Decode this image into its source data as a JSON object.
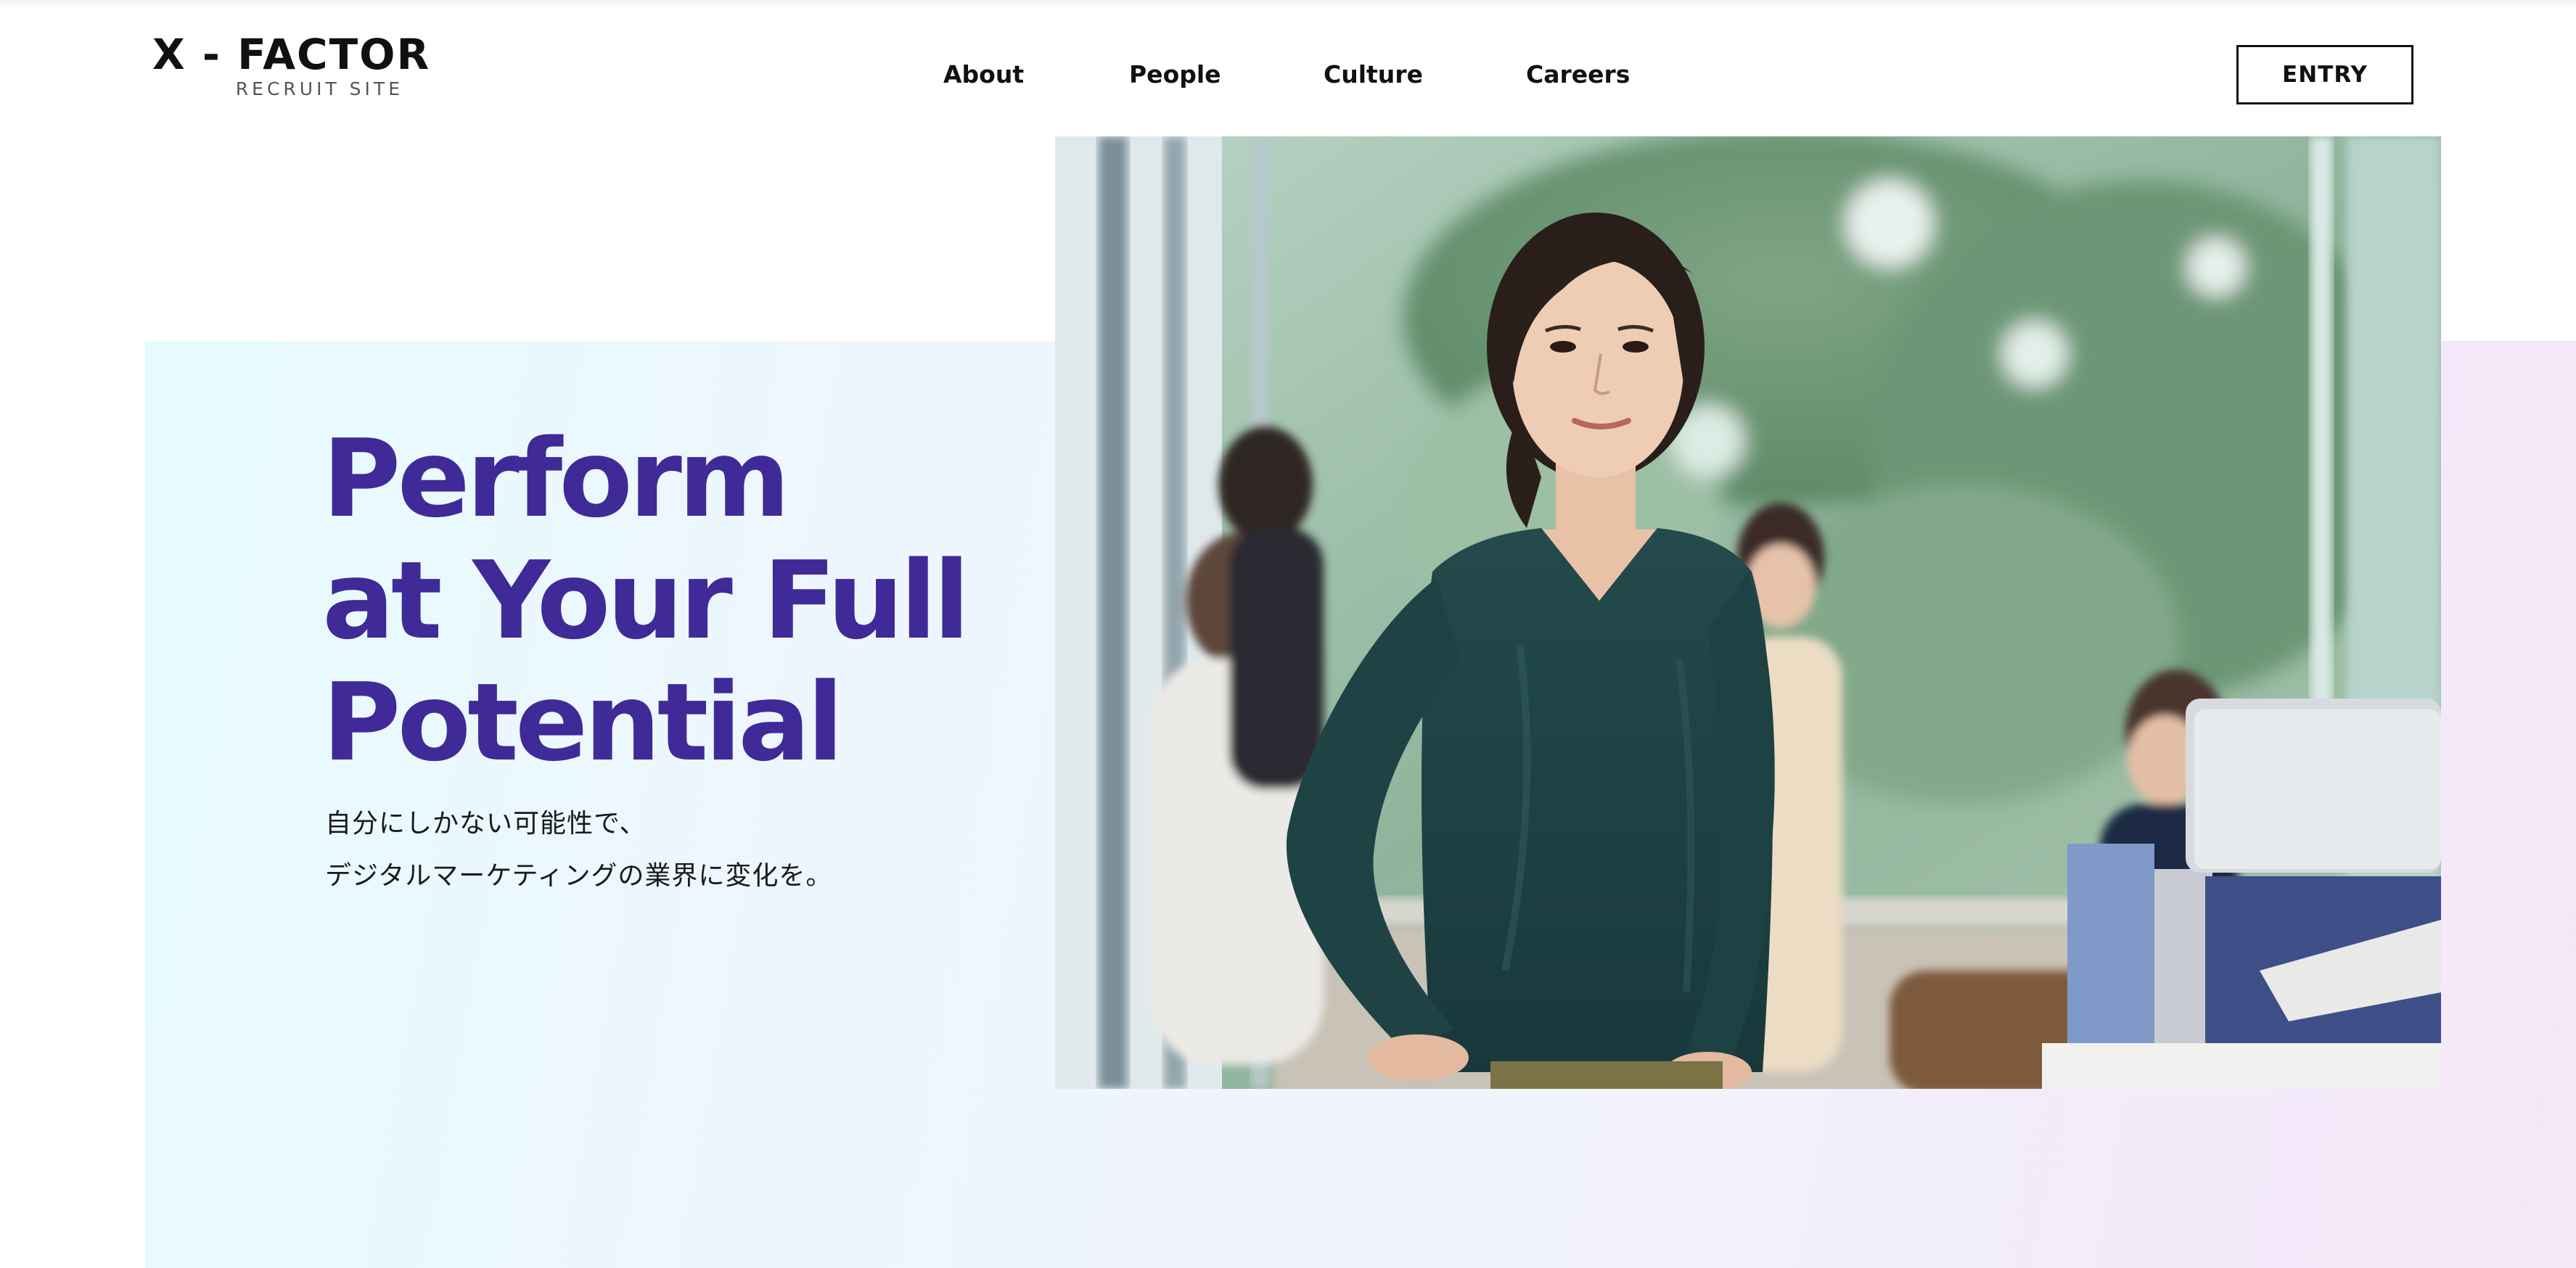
{
  "header": {
    "logo_main": "X - FACTOR",
    "logo_sub": "RECRUIT SITE",
    "nav": {
      "about": "About",
      "people": "People",
      "culture": "Culture",
      "careers": "Careers"
    },
    "entry_label": "ENTRY"
  },
  "hero": {
    "headline": [
      "Perform",
      "at Your Full",
      "Potential"
    ],
    "subcopy": [
      "自分にしかない可能性で、",
      "デジタルマーケティングの業界に変化を。"
    ]
  },
  "colors": {
    "headline": "#3f2a98",
    "text": "#111111",
    "hero_gradient_start": "#e6fbfe",
    "hero_gradient_end": "#f5e6f8"
  }
}
